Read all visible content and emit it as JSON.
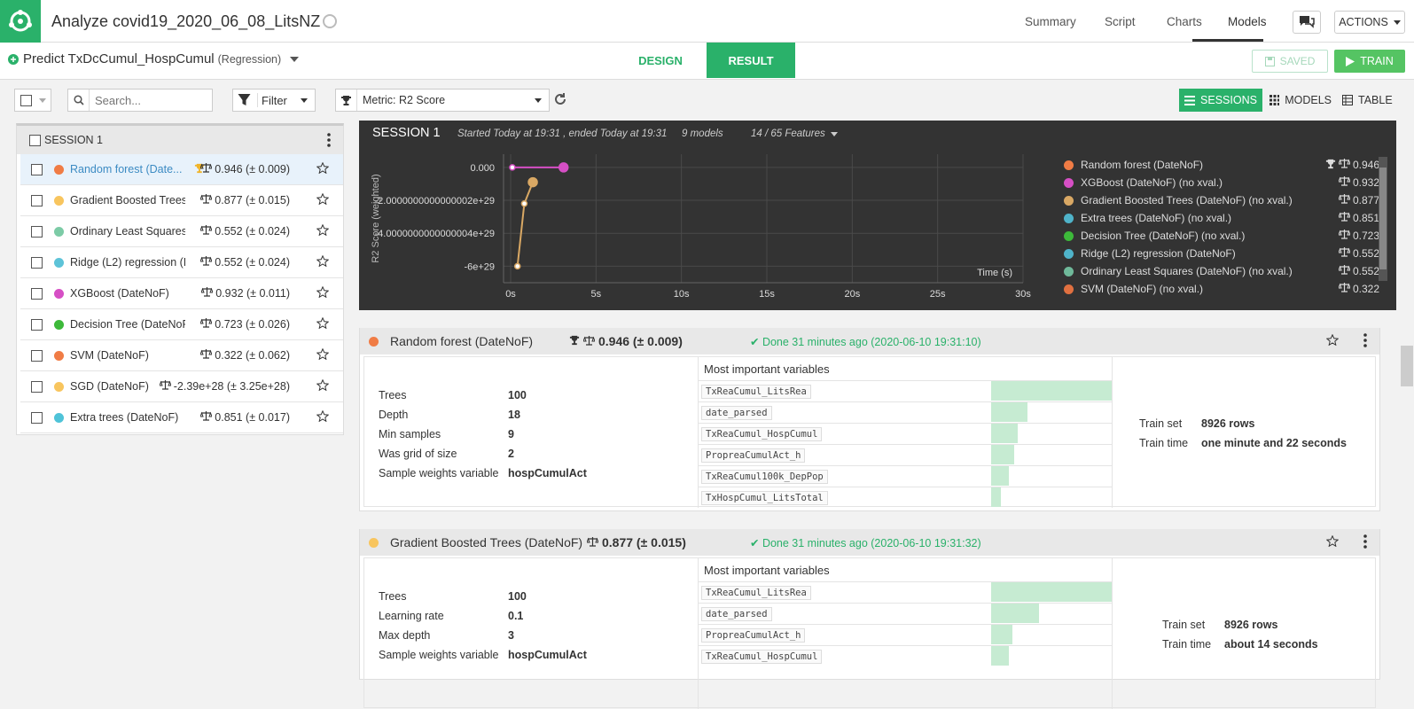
{
  "header": {
    "title": "Analyze covid19_2020_06_08_LitsNZ",
    "nav": [
      "Summary",
      "Script",
      "Charts",
      "Models"
    ],
    "active_nav": "Models",
    "actions_label": "ACTIONS"
  },
  "subheader": {
    "predict_label": "Predict TxDcCumul_HospCumul",
    "predict_type": "(Regression)",
    "design_tab": "DESIGN",
    "result_tab": "RESULT",
    "saved_label": "SAVED",
    "train_label": "TRAIN"
  },
  "toolbar": {
    "search_placeholder": "Search...",
    "filter_label": "Filter",
    "metric_label": "Metric: R2 Score",
    "sessions_label": "SESSIONS",
    "models_label": "MODELS",
    "table_label": "TABLE"
  },
  "session_list": {
    "title": "SESSION 1",
    "models": [
      {
        "name": "Random forest (DateNoF)",
        "display": "Random forest (Date...",
        "score": "0.946 (± 0.009)",
        "color": "#f07c45",
        "best": true,
        "selected": true
      },
      {
        "name": "Gradient Boosted Trees",
        "display": "Gradient Boosted Trees (...",
        "score": "0.877 (± 0.015)",
        "color": "#f8c55e",
        "best": false,
        "selected": false
      },
      {
        "name": "Ordinary Least Squares",
        "display": "Ordinary Least Squares (...",
        "score": "0.552 (± 0.024)",
        "color": "#7ccba6",
        "best": false,
        "selected": false
      },
      {
        "name": "Ridge (L2) regression",
        "display": "Ridge (L2) regression (Da...",
        "score": "0.552 (± 0.024)",
        "color": "#5dc3d8",
        "best": false,
        "selected": false
      },
      {
        "name": "XGBoost (DateNoF)",
        "display": "XGBoost (DateNoF)",
        "score": "0.932 (± 0.011)",
        "color": "#d64fc5",
        "best": false,
        "selected": false
      },
      {
        "name": "Decision Tree (DateNoF)",
        "display": "Decision Tree (DateNoF)",
        "score": "0.723 (± 0.026)",
        "color": "#3db93a",
        "best": false,
        "selected": false
      },
      {
        "name": "SVM (DateNoF)",
        "display": "SVM (DateNoF)",
        "score": "0.322 (± 0.062)",
        "color": "#f07c45",
        "best": false,
        "selected": false
      },
      {
        "name": "SGD (DateNoF)",
        "display": "SGD (DateNoF)",
        "score": "-2.39e+28 (± 3.25e+28)",
        "color": "#f8c55e",
        "best": false,
        "selected": false
      },
      {
        "name": "Extra trees (DateNoF)",
        "display": "Extra trees (DateNoF)",
        "score": "0.851 (± 0.017)",
        "color": "#4fc3d8",
        "best": false,
        "selected": false
      }
    ]
  },
  "session_chart": {
    "title": "SESSION 1",
    "started": "Started Today at 19:31 , ended Today at 19:31",
    "models_count": "9 models",
    "features": "14 / 65 Features",
    "legend": [
      {
        "name": "Random forest (DateNoF)",
        "score": "0.946",
        "color": "#f07c45",
        "best": true
      },
      {
        "name": "XGBoost (DateNoF) (no xval.)",
        "score": "0.932",
        "color": "#d64fc5",
        "best": false
      },
      {
        "name": "Gradient Boosted Trees (DateNoF) (no xval.)",
        "score": "0.877",
        "color": "#d9a864",
        "best": false
      },
      {
        "name": "Extra trees (DateNoF) (no xval.)",
        "score": "0.851",
        "color": "#4fb3c9",
        "best": false
      },
      {
        "name": "Decision Tree (DateNoF) (no xval.)",
        "score": "0.723",
        "color": "#3db93a",
        "best": false
      },
      {
        "name": "Ridge (L2) regression (DateNoF)",
        "score": "0.552",
        "color": "#4fb3c9",
        "best": false
      },
      {
        "name": "Ordinary Least Squares (DateNoF) (no xval.)",
        "score": "0.552",
        "color": "#6fb99a",
        "best": false
      },
      {
        "name": "SVM (DateNoF) (no xval.)",
        "score": "0.322",
        "color": "#e07040",
        "best": false
      }
    ]
  },
  "chart_data": {
    "type": "line",
    "ylabel": "R2 Score (weighted)",
    "xlabel": "Time (s)",
    "xlim": [
      0,
      30
    ],
    "ylim": [
      -7e+29,
      8e+28
    ],
    "x_ticks": [
      0,
      5,
      10,
      15,
      20,
      25,
      30
    ],
    "x_tick_labels": [
      "0s",
      "5s",
      "10s",
      "15s",
      "20s",
      "25s",
      "30s"
    ],
    "y_ticks": [
      0,
      -2e+29,
      -4e+29,
      -6e+29
    ],
    "y_tick_labels": [
      "0.000",
      "-2.0000000000000002e+29",
      "-4.0000000000000004e+29",
      "-6e+29"
    ],
    "series": [
      {
        "color": "#d64fc5",
        "points": [
          [
            0.1,
            0
          ],
          [
            3.1,
            0
          ]
        ]
      },
      {
        "color": "#d9a864",
        "points": [
          [
            0.4,
            -6e+29
          ],
          [
            0.8,
            -2.2e+29
          ],
          [
            1.3,
            -9e+28
          ]
        ]
      }
    ]
  },
  "cards": [
    {
      "name": "Random forest (DateNoF)",
      "color": "#f07c45",
      "score": "0.946 (± 0.009)",
      "best": true,
      "done": "Done 31 minutes ago (2020-06-10 19:31:10)",
      "params": [
        {
          "k": "Trees",
          "v": "100"
        },
        {
          "k": "Depth",
          "v": "18"
        },
        {
          "k": "Min samples",
          "v": "9"
        },
        {
          "k": "Was grid of size",
          "v": "2"
        },
        {
          "k": "Sample weights variable",
          "v": "hospCumulAct"
        }
      ],
      "vars_title": "Most important variables",
      "vars": [
        {
          "name": "TxReaCumul_LitsRea",
          "importance": 1.0
        },
        {
          "name": "date_parsed",
          "importance": 0.3
        },
        {
          "name": "TxReaCumul_HospCumul",
          "importance": 0.22
        },
        {
          "name": "PropreaCumulAct_h",
          "importance": 0.19
        },
        {
          "name": "TxReaCumul100k_DepPop",
          "importance": 0.15
        },
        {
          "name": "TxHospCumul_LitsTotal",
          "importance": 0.08
        }
      ],
      "train_set_label": "Train set",
      "train_set": "8926 rows",
      "train_time_label": "Train time",
      "train_time": "one minute and 22 seconds"
    },
    {
      "name": "Gradient Boosted Trees (DateNoF)",
      "color": "#f8c55e",
      "score": "0.877 (± 0.015)",
      "best": false,
      "done": "Done 31 minutes ago (2020-06-10 19:31:32)",
      "params": [
        {
          "k": "Trees",
          "v": "100"
        },
        {
          "k": "Learning rate",
          "v": "0.1"
        },
        {
          "k": "Max depth",
          "v": "3"
        },
        {
          "k": "Sample weights variable",
          "v": "hospCumulAct"
        }
      ],
      "vars_title": "Most important variables",
      "vars": [
        {
          "name": "TxReaCumul_LitsRea",
          "importance": 1.0
        },
        {
          "name": "date_parsed",
          "importance": 0.4
        },
        {
          "name": "PropreaCumulAct_h",
          "importance": 0.18
        },
        {
          "name": "TxReaCumul_HospCumul",
          "importance": 0.15
        }
      ],
      "train_set_label": "Train set",
      "train_set": "8926 rows",
      "train_time_label": "Train time",
      "train_time": "about 14 seconds"
    }
  ]
}
